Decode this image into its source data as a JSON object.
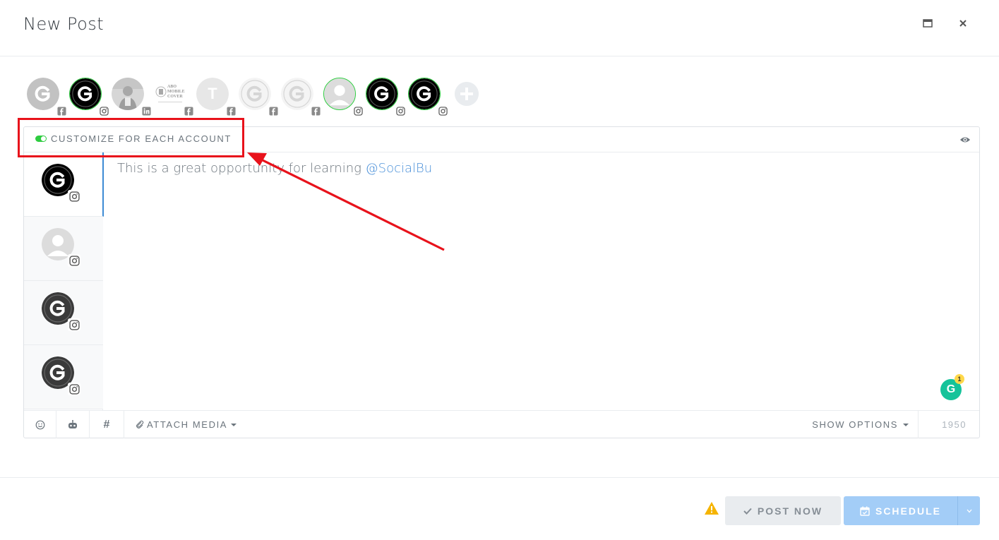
{
  "header": {
    "title": "New Post"
  },
  "accounts": [
    {
      "name": "account-1",
      "network": "facebook",
      "style": "g-gray",
      "selected": false
    },
    {
      "name": "account-2",
      "network": "instagram",
      "style": "g-black",
      "selected": true
    },
    {
      "name": "account-3",
      "network": "linkedin",
      "style": "photo",
      "selected": false
    },
    {
      "name": "account-4",
      "network": "facebook",
      "style": "logo-text",
      "selected": false,
      "logo_lines": [
        "ABO",
        "MOBILE",
        "COVER"
      ]
    },
    {
      "name": "account-5",
      "network": "facebook",
      "style": "letter",
      "letter": "T",
      "selected": false
    },
    {
      "name": "account-6",
      "network": "facebook",
      "style": "g-outline",
      "selected": false
    },
    {
      "name": "account-7",
      "network": "facebook",
      "style": "g-outline",
      "selected": false
    },
    {
      "name": "account-8",
      "network": "instagram",
      "style": "person",
      "selected": true
    },
    {
      "name": "account-9",
      "network": "instagram",
      "style": "g-black",
      "selected": true
    },
    {
      "name": "account-10",
      "network": "instagram",
      "style": "g-black",
      "selected": true
    }
  ],
  "editor": {
    "customize_label": "CUSTOMIZE FOR EACH ACCOUNT",
    "text": "This is a great opportunity for learning ",
    "mention": "@SocialBu",
    "grammarly_count": "1"
  },
  "side_accounts": [
    {
      "style": "g-black",
      "network": "instagram",
      "active": true
    },
    {
      "style": "person",
      "network": "instagram",
      "active": false
    },
    {
      "style": "g-dark",
      "network": "instagram",
      "active": false
    },
    {
      "style": "g-dark",
      "network": "instagram",
      "active": false
    }
  ],
  "toolbar": {
    "attach_media_label": "ATTACH MEDIA",
    "show_options_label": "SHOW OPTIONS",
    "char_count": "1950"
  },
  "footer": {
    "post_now_label": "POST NOW",
    "schedule_label": "SCHEDULE"
  },
  "colors": {
    "accent_blue": "#a3cdf7",
    "toggle_green": "#2ecc40",
    "annotation_red": "#e8121b",
    "mention_blue": "#4a90d9",
    "warning_yellow": "#f5b400"
  }
}
